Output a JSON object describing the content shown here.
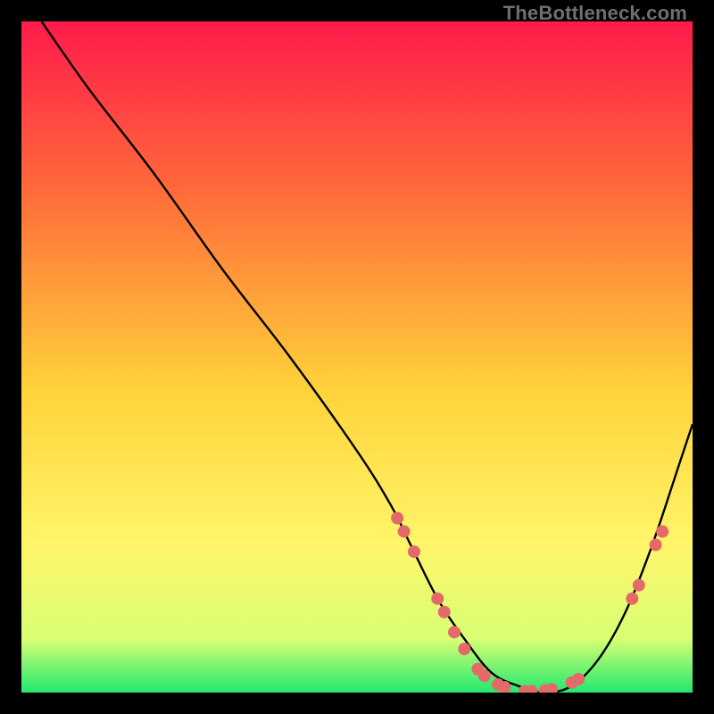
{
  "watermark": "TheBottleneck.com",
  "chart_data": {
    "type": "line",
    "title": "",
    "xlabel": "",
    "ylabel": "",
    "xlim": [
      0,
      100
    ],
    "ylim": [
      0,
      100
    ],
    "gradient_stops": [
      {
        "offset": 0,
        "color": "#ff1a4b"
      },
      {
        "offset": 25,
        "color": "#ff6a3a"
      },
      {
        "offset": 55,
        "color": "#ffd33a"
      },
      {
        "offset": 78,
        "color": "#fff66a"
      },
      {
        "offset": 92,
        "color": "#d8ff74"
      },
      {
        "offset": 100,
        "color": "#22e86f"
      }
    ],
    "series": [
      {
        "name": "bottleneck-curve",
        "x": [
          3,
          10,
          20,
          30,
          40,
          50,
          55,
          58,
          62,
          66,
          70,
          74,
          78,
          82,
          86,
          90,
          94,
          98,
          100
        ],
        "y": [
          100,
          90,
          77,
          63,
          50,
          36,
          28,
          22,
          14,
          8,
          3,
          1,
          0,
          1,
          5,
          12,
          22,
          34,
          40
        ]
      }
    ],
    "markers": {
      "name": "data-points",
      "color": "#e46a6a",
      "radius": 7,
      "points": [
        {
          "x": 56,
          "y": 26
        },
        {
          "x": 57,
          "y": 24
        },
        {
          "x": 58.5,
          "y": 21
        },
        {
          "x": 62,
          "y": 14
        },
        {
          "x": 63,
          "y": 12
        },
        {
          "x": 64.5,
          "y": 9
        },
        {
          "x": 66,
          "y": 6.5
        },
        {
          "x": 68,
          "y": 3.5
        },
        {
          "x": 69,
          "y": 2.5
        },
        {
          "x": 71,
          "y": 1.2
        },
        {
          "x": 72,
          "y": 0.8
        },
        {
          "x": 75,
          "y": 0.2
        },
        {
          "x": 76,
          "y": 0.2
        },
        {
          "x": 78,
          "y": 0.3
        },
        {
          "x": 79,
          "y": 0.5
        },
        {
          "x": 82,
          "y": 1.5
        },
        {
          "x": 83,
          "y": 2
        },
        {
          "x": 91,
          "y": 14
        },
        {
          "x": 92,
          "y": 16
        },
        {
          "x": 94.5,
          "y": 22
        },
        {
          "x": 95.5,
          "y": 24
        }
      ]
    }
  }
}
